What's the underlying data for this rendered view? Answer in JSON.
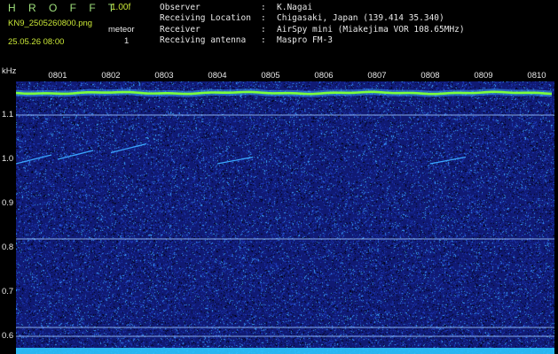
{
  "header": {
    "app_title": "H R O F F T",
    "app_version": "1.00f",
    "file_name": "KN9_2505260800.png",
    "datetime": "25.05.26 08:00",
    "sub_label": "meteor",
    "sub_value": "1"
  },
  "metadata": [
    {
      "key": "Observer",
      "value": "K.Nagai"
    },
    {
      "key": "Receiving Location",
      "value": "Chigasaki, Japan (139.414 35.340)"
    },
    {
      "key": "Receiver",
      "value": "AirSpy mini (Miakejima VOR 108.65MHz)"
    },
    {
      "key": "Receiving antenna",
      "value": "Maspro FM-3"
    }
  ],
  "chart_data": {
    "type": "heatmap",
    "y_unit_label": "kHz",
    "y_ticks": [
      "1.1",
      "1.0",
      "0.9",
      "0.8",
      "0.7",
      "0.6"
    ],
    "x_ticks": [
      "0801",
      "0802",
      "0803",
      "0804",
      "0805",
      "0806",
      "0807",
      "0808",
      "0809",
      "0810"
    ],
    "ylim": [
      0.58,
      1.18
    ],
    "carrier_khz": 1.15,
    "reference_lines_khz": [
      1.1,
      0.82,
      0.62,
      0.6
    ],
    "meteor_pings": [
      {
        "time": "0800",
        "khz_start": 0.99,
        "khz_end": 1.01
      },
      {
        "time": "0801",
        "khz_start": 1.0,
        "khz_end": 1.02
      },
      {
        "time": "0802",
        "khz_start": 1.015,
        "khz_end": 1.035
      },
      {
        "time": "0804",
        "khz_start": 0.99,
        "khz_end": 1.005
      },
      {
        "time": "0808",
        "khz_start": 0.99,
        "khz_end": 1.005
      }
    ],
    "colors": {
      "background": "#000000",
      "noise_low": "#101a74",
      "noise_mid": "#1f3fbf",
      "noise_high": "#3aa6ff",
      "carrier": "#7dff3a",
      "reference": "#9fc8ff",
      "baseline": "#2ec8ff"
    }
  }
}
